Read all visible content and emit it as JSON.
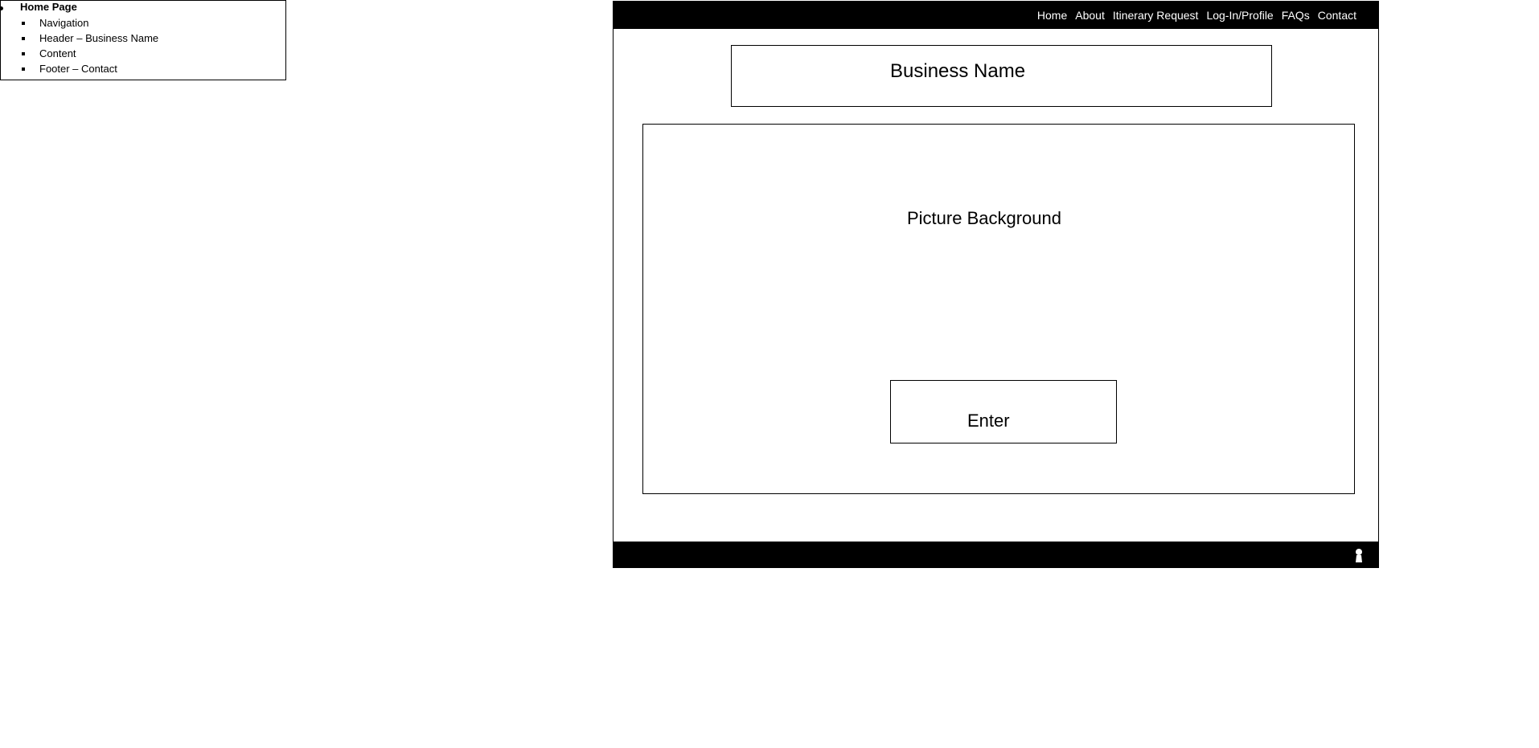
{
  "outline": {
    "top_item": "Home Page",
    "sub_items": [
      "Navigation",
      "Header – Business Name",
      "Content",
      "Footer – Contact"
    ]
  },
  "nav": {
    "links": [
      "Home",
      "About",
      "Itinerary Request",
      "Log-In/Profile",
      "FAQs",
      "Contact"
    ]
  },
  "header": {
    "business_name": "Business Name"
  },
  "content": {
    "picture_label": "Picture Background",
    "enter_label": "Enter"
  },
  "footer": {
    "icon": "contact-person-icon"
  }
}
